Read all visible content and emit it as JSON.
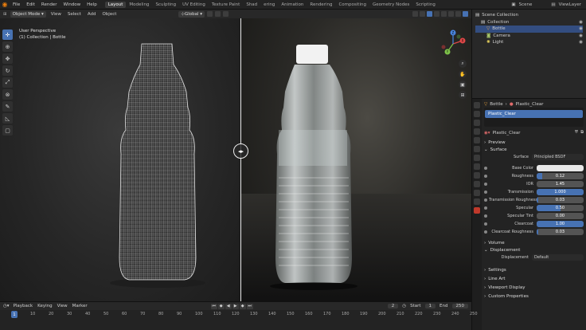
{
  "topbar": {
    "menus": [
      "File",
      "Edit",
      "Render",
      "Window",
      "Help"
    ],
    "workspaces": [
      "Layout",
      "Modeling",
      "Sculpting",
      "UV Editing",
      "Texture Paint",
      "Shad",
      "ering",
      "Animation",
      "Rendering",
      "Compositing",
      "Geometry Nodes",
      "Scripting"
    ],
    "scene": "Scene",
    "view_layer": "ViewLayer"
  },
  "viewport_header": {
    "mode": "Object Mode",
    "menus": [
      "View",
      "Select",
      "Add",
      "Object"
    ],
    "transform": "Global",
    "sel_label": "Sel"
  },
  "viewport": {
    "line1": "User Perspective",
    "line2": "(1) Collection | Bottle",
    "gizmo_axes": [
      "X",
      "Y",
      "Z"
    ]
  },
  "outliner": {
    "rows": [
      {
        "name": "Scene Collection",
        "icon": "collection-icon",
        "indent": 0
      },
      {
        "name": "Collection",
        "icon": "collection-icon",
        "indent": 1
      },
      {
        "name": "Bottle",
        "icon": "mesh-icon",
        "indent": 2,
        "selected": true
      },
      {
        "name": "Camera",
        "icon": "camera-icon",
        "indent": 2
      },
      {
        "name": "Light",
        "icon": "light-icon",
        "indent": 2
      }
    ]
  },
  "properties": {
    "object": "Bottle",
    "material": "Plastic_Clear",
    "slot": "Plastic_Clear",
    "datablock": "Plastic_Clear",
    "sections": {
      "preview": "Preview",
      "surface": "Surface",
      "volume": "Volume",
      "displacement": "Displacement",
      "settings": "Settings",
      "lineart": "Line Art",
      "viewport_display": "Viewport Display",
      "custom_props": "Custom Properties"
    },
    "surface_label": "Surface",
    "surface_value": "Principled BSDF",
    "displacement_label": "Displacement",
    "displacement_value": "Default",
    "fields": [
      {
        "label": "Base Color",
        "type": "color",
        "color": "#e6e6e6"
      },
      {
        "label": "Roughness",
        "value": "0.12",
        "fraction": 0.12
      },
      {
        "label": "IOR",
        "value": "1.45",
        "fraction": 0
      },
      {
        "label": "Transmission",
        "value": "1.000",
        "fraction": 1
      },
      {
        "label": "Transmission Roughness",
        "value": "0.03",
        "fraction": 0.03
      },
      {
        "label": "Specular",
        "value": "0.50",
        "fraction": 0.5
      },
      {
        "label": "Specular Tint",
        "value": "0.00",
        "fraction": 0
      },
      {
        "label": "Clearcoat",
        "value": "1.00",
        "fraction": 1
      },
      {
        "label": "Clearcoat Roughness",
        "value": "0.03",
        "fraction": 0.03
      }
    ]
  },
  "timeline": {
    "menus": [
      "Playback",
      "Keying",
      "View",
      "Marker"
    ],
    "current_frame": "2",
    "start_label": "Start",
    "start": "1",
    "end_label": "End",
    "end": "250",
    "playhead": "1",
    "ticks": [
      "10",
      "20",
      "30",
      "40",
      "50",
      "60",
      "70",
      "80",
      "90",
      "100",
      "110",
      "120",
      "130",
      "140",
      "150",
      "160",
      "170",
      "180",
      "190",
      "200",
      "210",
      "220",
      "230",
      "240",
      "250"
    ]
  }
}
